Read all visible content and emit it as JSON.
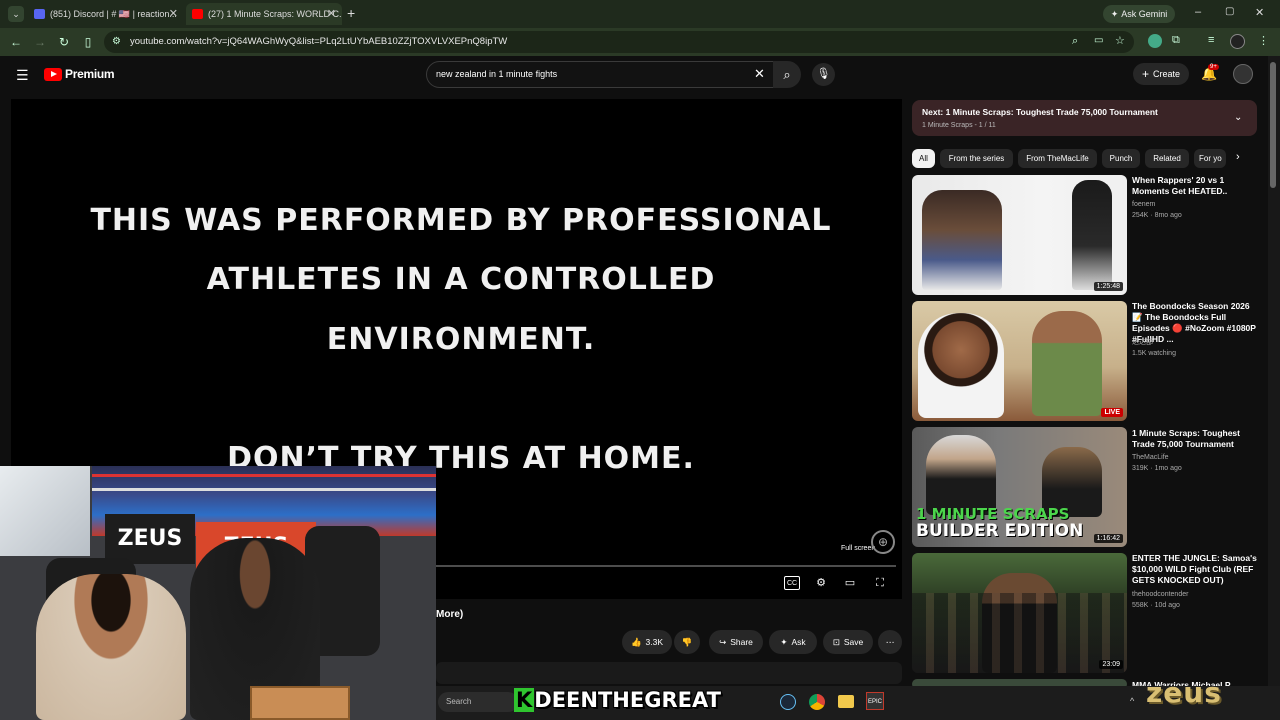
{
  "browser": {
    "tabs": [
      {
        "label": "(851) Discord | # 🇺🇸 | reaction..."
      },
      {
        "label": "(27) 1 Minute Scraps: WORLD C..."
      }
    ],
    "new_tab": "+",
    "ask_gemini": "Ask Gemini",
    "url": "youtube.com/watch?v=jQ64WAGhWyQ&list=PLq2LtUYbAEB10ZZjTOXVLVXEPnQ8ipTW"
  },
  "youtube": {
    "logo": "Premium",
    "search_value": "new zealand in 1 minute fights",
    "create_label": "Create",
    "notifications_badge": "9+"
  },
  "player": {
    "lines": [
      "THIS WAS PERFORMED BY PROFESSIONAL",
      "ATHLETES IN A CONTROLLED",
      "ENVIRONMENT.",
      "DON’T TRY THIS AT HOME."
    ],
    "tooltip": "Full screen",
    "more_label": "More)"
  },
  "actions": {
    "likes": "3.3K",
    "share": "Share",
    "ask": "Ask",
    "save": "Save"
  },
  "playlist": {
    "next_title": "Next: 1 Minute Scraps: Toughest Trade 75,000 Tournament",
    "sub": "1 Minute Scraps - 1 / 11"
  },
  "chips": [
    "All",
    "From the series",
    "From TheMacLife",
    "Punch",
    "Related",
    "For yo"
  ],
  "videos": [
    {
      "title": "When Rappers' 20 vs 1 Moments Get HEATED..",
      "channel": "foenem",
      "meta": "254K · 8mo ago",
      "duration": "1:25:48"
    },
    {
      "title": "The Boondocks Season 2026 📝 The Boondocks Full Episodes 🔴 #NoZoom #1080P #FullHD ...",
      "channel": "达达部",
      "meta": "1.5K watching",
      "duration": "LIVE"
    },
    {
      "title": "1 Minute Scraps: Toughest Trade 75,000 Tournament",
      "channel": "TheMacLife",
      "meta": "319K · 1mo ago",
      "duration": "1:16:42",
      "overlay1": "1 MINUTE SCRAPS",
      "overlay2": "BUILDER EDITION"
    },
    {
      "title": "ENTER THE JUNGLE: Samoa's $10,000 WILD Fight Club (REF GETS KNOCKED OUT)",
      "channel": "thehoodcontender",
      "meta": "558K · 10d ago",
      "duration": "23:09"
    },
    {
      "title": "MMA Warriors Michael P",
      "channel": "",
      "meta": "",
      "duration": ""
    }
  ],
  "taskbar": {
    "search": "Search",
    "banner_k": "K",
    "banner": "DEENTHEGREAT",
    "sponsor": "zeus"
  },
  "colors": {
    "yt_red": "#ff0000",
    "accent_green": "#2fc52f",
    "zeus_gold": "#d9bf73"
  }
}
